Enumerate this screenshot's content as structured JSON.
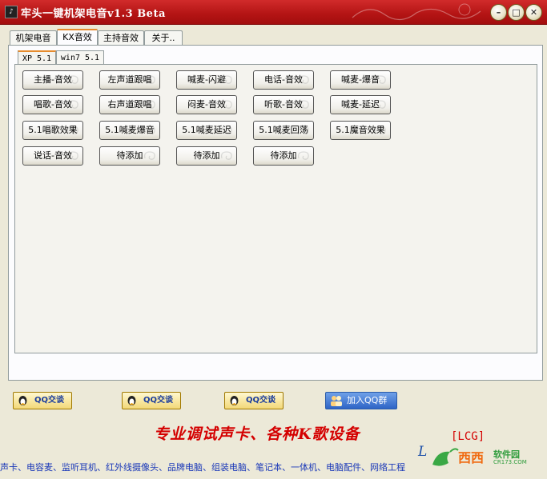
{
  "window": {
    "title": "牢头一键机架电音v1.3 Beta",
    "app_icon": "app-icon",
    "controls": [
      "minimize",
      "maximize",
      "close"
    ],
    "control_glyphs": {
      "minimize": "–",
      "maximize": "□",
      "close": "✕"
    }
  },
  "tabs": [
    {
      "label": "机架电音",
      "active": false
    },
    {
      "label": "KX音效",
      "active": true
    },
    {
      "label": "主持音效",
      "active": false
    },
    {
      "label": "关于..",
      "active": false
    }
  ],
  "subtabs": [
    {
      "label": "XP 5.1",
      "active": true
    },
    {
      "label": "win7 5.1",
      "active": false
    }
  ],
  "effect_buttons": [
    [
      "主播-音效",
      "左声道跟唱",
      "喊麦-闪避",
      "电话-音效",
      "喊麦-爆音"
    ],
    [
      "唱歌-音效",
      "右声道跟唱",
      "闷麦-音效",
      "听歌-音效",
      "喊麦-延迟"
    ],
    [
      "5.1唱歌效果",
      "5.1喊麦爆音",
      "5.1喊麦延迟",
      "5.1喊麦回荡",
      "5.1魔音效果"
    ],
    [
      "说话-音效",
      "待添加",
      "待添加",
      "待添加"
    ]
  ],
  "bottom": {
    "qq_buttons": [
      "QQ交谈",
      "QQ交谈",
      "QQ交谈"
    ],
    "group_button": "加入QQ群",
    "slogan": "专业调试声卡、各种K歌设备",
    "lcg": "[LCG]",
    "l_letter": "L",
    "marquee": "声卡、电容麦、监听耳机、红外线摄像头、品牌电脑、组装电脑、笔记本、一体机、电脑配件、网络工程",
    "watermark": {
      "main": "西西",
      "sub": "软件园",
      "url": "CR173.COM"
    }
  },
  "colors": {
    "title_bar": "#b31414",
    "accent_tab": "#e68b2c",
    "slogan": "#d40000",
    "marquee": "#1a38b8"
  }
}
